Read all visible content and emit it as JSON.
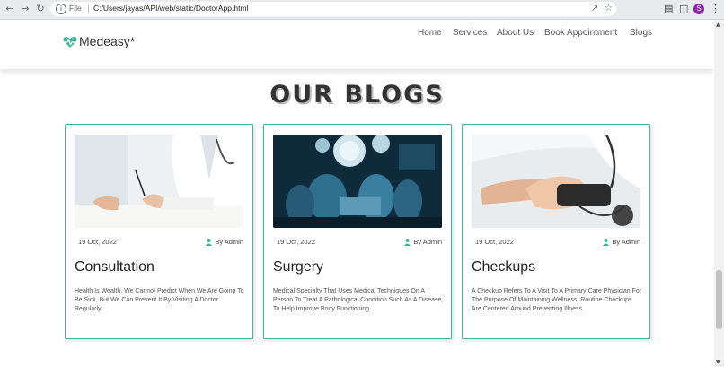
{
  "browser": {
    "scheme": "File",
    "url": "C:/Users/jayas/API/web/static/DoctorApp.html",
    "avatar_letter": "S",
    "back_icon": "arrow-left-icon",
    "forward_icon": "arrow-right-icon",
    "reload_icon": "reload-icon"
  },
  "site": {
    "logo_text": "Medeasy*",
    "accent_color": "#3fb39d",
    "nav": [
      "Home",
      "Services",
      "About Us",
      "Book Appointment",
      "Blogs"
    ]
  },
  "blogs": {
    "title": "OUR BLOGS",
    "cards": [
      {
        "date": "19 Oct, 2022",
        "author": "By Admin",
        "title": "Consultation",
        "description": "Health Is Wealth. We Cannot Predict When We Are Going To Be Sick, But We Can Prevent It By Visiting A Doctor Regularly.",
        "image": "doctor-writing-image"
      },
      {
        "date": "19 Oct, 2022",
        "author": "By Admin",
        "title": "Surgery",
        "description": "Medical Specialty That Uses Medical Techniques On A Person To Treat A Pathological Condition Such As A Disease, To Help Improve Body Functioning.",
        "image": "operating-room-image"
      },
      {
        "date": "19 Oct, 2022",
        "author": "By Admin",
        "title": "Checkups",
        "description": "A Checkup Refers To A Visit To A Primary Care Physician For The Purpose Of Maintaining Wellness. Routine Checkups Are Centered Around Preventing Illness.",
        "image": "blood-pressure-image"
      }
    ]
  }
}
